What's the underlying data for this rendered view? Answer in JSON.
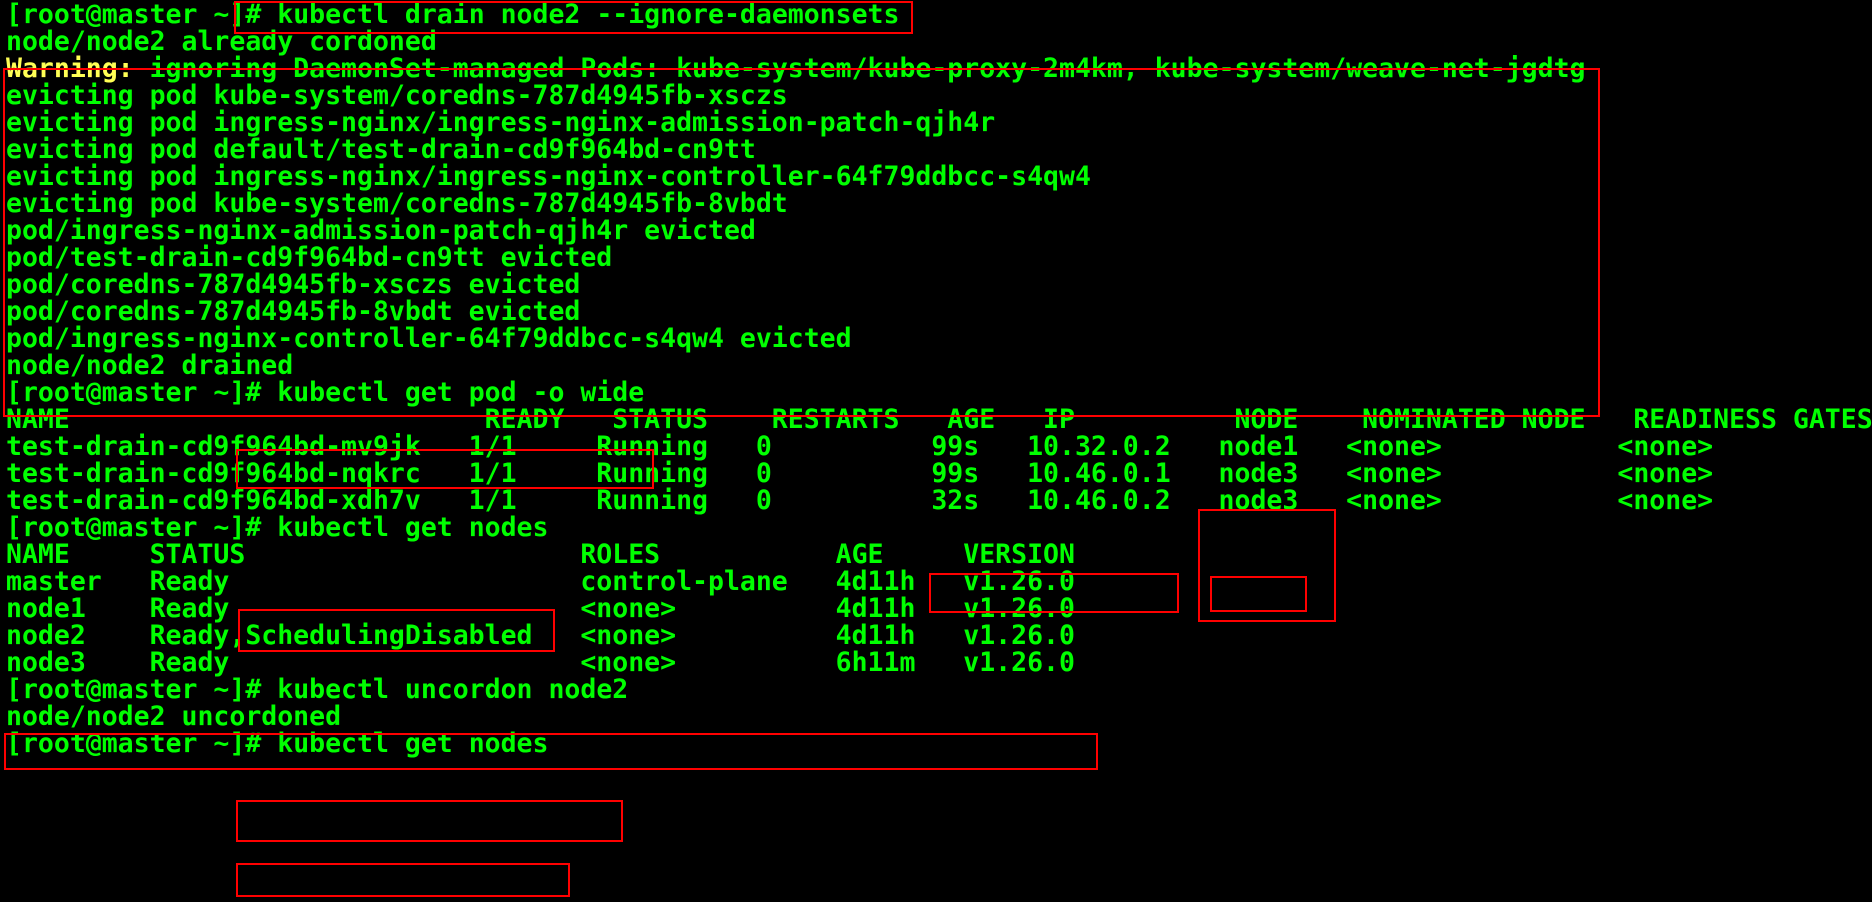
{
  "colors": {
    "background": "#000000",
    "text": "#00ff00",
    "warning": "#ffff55",
    "highlight": "#ff0000"
  },
  "lines": [
    {
      "prompt": "[root@master ~]",
      "cmd": "# kubectl drain node2 --ignore-daemonsets"
    },
    {
      "text": "node/node2 already cordoned"
    },
    {
      "prefix": "Warning:",
      "text": " ignoring DaemonSet-managed Pods: kube-system/kube-proxy-2m4km, kube-system/weave-net-jgdtg"
    },
    {
      "text": "evicting pod kube-system/coredns-787d4945fb-xsczs"
    },
    {
      "text": "evicting pod ingress-nginx/ingress-nginx-admission-patch-qjh4r"
    },
    {
      "text": "evicting pod default/test-drain-cd9f964bd-cn9tt"
    },
    {
      "text": "evicting pod ingress-nginx/ingress-nginx-controller-64f79ddbcc-s4qw4"
    },
    {
      "text": "evicting pod kube-system/coredns-787d4945fb-8vbdt"
    },
    {
      "text": "pod/ingress-nginx-admission-patch-qjh4r evicted"
    },
    {
      "text": "pod/test-drain-cd9f964bd-cn9tt evicted"
    },
    {
      "text": "pod/coredns-787d4945fb-xsczs evicted"
    },
    {
      "text": "pod/coredns-787d4945fb-8vbdt evicted"
    },
    {
      "text": "pod/ingress-nginx-controller-64f79ddbcc-s4qw4 evicted"
    },
    {
      "text": "node/node2 drained"
    },
    {
      "prompt": "[root@master ~]",
      "cmd": "# kubectl get pod -o wide"
    },
    {
      "text": "NAME                          READY   STATUS    RESTARTS   AGE   IP          NODE    NOMINATED NODE   READINESS GATES"
    },
    {
      "text": "test-drain-cd9f964bd-mv9jk   1/1     Running   0          99s   10.32.0.2   node1   <none>           <none>"
    },
    {
      "text": "test-drain-cd9f964bd-nqkrc   1/1     Running   0          99s   10.46.0.1   node3   <none>           <none>"
    },
    {
      "text": "test-drain-cd9f964bd-xdh7v   1/1     Running   0          32s   10.46.0.2   node3   <none>           <none>"
    },
    {
      "prompt": "[root@master ~]",
      "cmd": "# kubectl get nodes"
    },
    {
      "text": "NAME     STATUS                     ROLES           AGE     VERSION"
    },
    {
      "text": "master   Ready                      control-plane   4d11h   v1.26.0"
    },
    {
      "text": "node1    Ready                      <none>          4d11h   v1.26.0"
    },
    {
      "text": "node2    Ready,SchedulingDisabled   <none>          4d11h   v1.26.0"
    },
    {
      "text": "node3    Ready                      <none>          6h11m   v1.26.0"
    },
    {
      "prompt": "[root@master ~]",
      "cmd": "# kubectl uncordon node2"
    },
    {
      "text": "node/node2 uncordoned"
    },
    {
      "prompt": "[root@master ~]",
      "cmd": "# kubectl get nodes"
    }
  ]
}
